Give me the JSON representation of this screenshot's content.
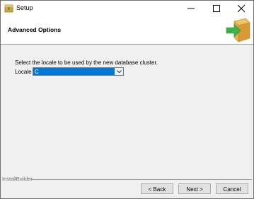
{
  "window": {
    "title": "Setup",
    "icon": "installer-box-icon",
    "controls": [
      "minimize-icon",
      "maximize-icon",
      "close-icon"
    ]
  },
  "header": {
    "title": "Advanced Options",
    "icon": "green-arrow-into-box-icon"
  },
  "main": {
    "description": "Select the locale to be used by the new database cluster.",
    "locale_label": "Locale",
    "locale_value": "C"
  },
  "footer": {
    "brand": "InstallBuilder",
    "back_label": "< Back",
    "next_label": "Next >",
    "cancel_label": "Cancel"
  },
  "colors": {
    "selection": "#0078d7",
    "window_bg": "#f0f0f0",
    "header_bg": "#ffffff",
    "arrow_green": "#3fb349",
    "box_tan": "#e8b14a"
  }
}
